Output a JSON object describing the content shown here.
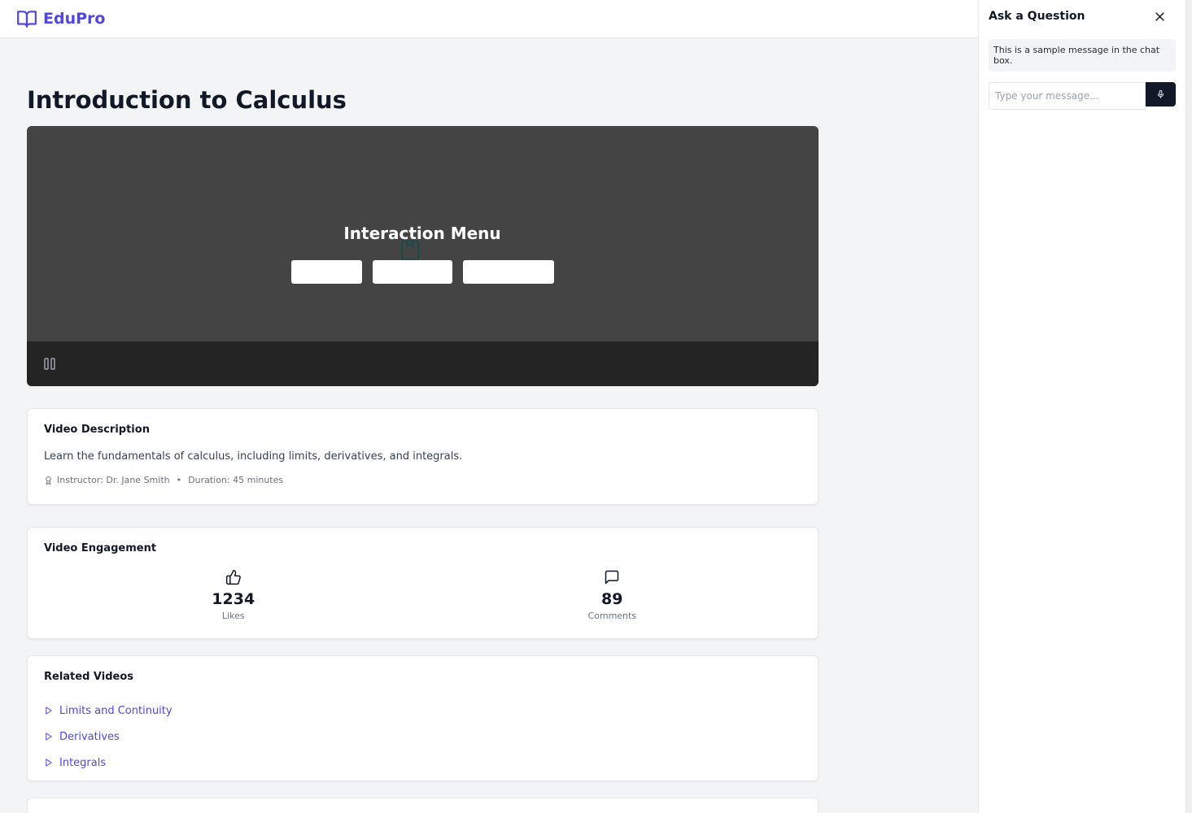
{
  "header": {
    "brand": "EduPro",
    "logo_icon": "book-open-icon",
    "brand_color": "#4f46e5"
  },
  "main": {
    "title": "Introduction to Calculus",
    "player": {
      "menu_title": "Interaction Menu",
      "pause_icon": "pause-icon"
    },
    "description": {
      "title": "Video Description",
      "text": "Learn the fundamentals of calculus, including limits, derivatives, and integrals.",
      "instructor": "Instructor: Dr. Jane Smith",
      "separator": "•",
      "duration": "Duration: 45 minutes"
    },
    "engagement": {
      "title": "Video Engagement",
      "likes": {
        "count": "1234",
        "label": "Likes",
        "icon": "thumbs-up-icon"
      },
      "comments": {
        "count": "89",
        "label": "Comments",
        "icon": "message-square-icon"
      }
    },
    "related": {
      "title": "Related Videos",
      "items": [
        {
          "label": "Limits and Continuity"
        },
        {
          "label": "Derivatives"
        },
        {
          "label": "Integrals"
        }
      ]
    }
  },
  "chat": {
    "title": "Ask a Question",
    "message": "This is a sample message in the chat box.",
    "placeholder": "Type your message...",
    "dark_color": "#111827"
  }
}
